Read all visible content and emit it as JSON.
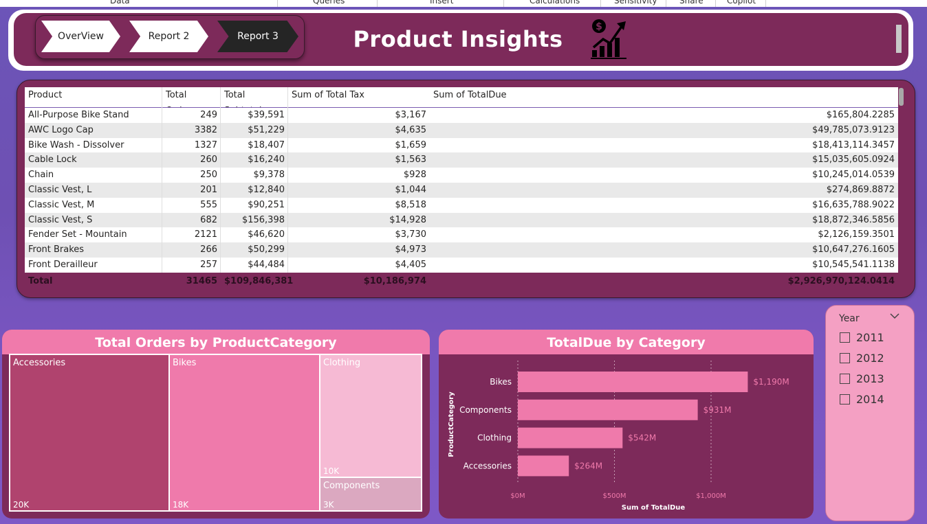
{
  "ribbon": {
    "tabs": [
      "Data",
      "Queries",
      "Insert",
      "Calculations",
      "Sensitivity",
      "Share",
      "Copilot"
    ]
  },
  "header": {
    "title": "Product Insights",
    "nav": [
      {
        "label": "OverView",
        "active": false
      },
      {
        "label": "Report 2",
        "active": false
      },
      {
        "label": "Report 3",
        "active": true
      }
    ],
    "icon": "dollar-growth-chart-icon"
  },
  "table": {
    "columns": [
      "Product",
      "Total Orders",
      "Total Subtotal",
      "Sum of Total Tax",
      "Sum of TotalDue"
    ],
    "rows": [
      [
        "All-Purpose Bike Stand",
        "249",
        "$39,591",
        "$3,167",
        "$165,804.2285"
      ],
      [
        "AWC Logo Cap",
        "3382",
        "$51,229",
        "$4,635",
        "$49,785,073.9123"
      ],
      [
        "Bike Wash - Dissolver",
        "1327",
        "$18,407",
        "$1,659",
        "$18,413,114.3457"
      ],
      [
        "Cable Lock",
        "260",
        "$16,240",
        "$1,563",
        "$15,035,605.0924"
      ],
      [
        "Chain",
        "250",
        "$9,378",
        "$928",
        "$10,245,014.0539"
      ],
      [
        "Classic Vest, L",
        "201",
        "$12,840",
        "$1,044",
        "$274,869.8872"
      ],
      [
        "Classic Vest, M",
        "555",
        "$90,251",
        "$8,518",
        "$16,635,788.9022"
      ],
      [
        "Classic Vest, S",
        "682",
        "$156,398",
        "$14,928",
        "$18,872,346.5856"
      ],
      [
        "Fender Set - Mountain",
        "2121",
        "$46,620",
        "$3,730",
        "$2,126,159.3501"
      ],
      [
        "Front Brakes",
        "266",
        "$50,299",
        "$4,973",
        "$10,647,276.1605"
      ],
      [
        "Front Derailleur",
        "257",
        "$44,484",
        "$4,405",
        "$10,545,541.1138"
      ]
    ],
    "total": [
      "Total",
      "31465",
      "$109,846,381",
      "$10,186,974",
      "$2,926,970,124.0414"
    ]
  },
  "treemap": {
    "title": "Total Orders by ProductCategory",
    "items": [
      {
        "label": "Accessories",
        "value_label": "20K",
        "color": "#b0436e"
      },
      {
        "label": "Bikes",
        "value_label": "18K",
        "color": "#ef7aab"
      },
      {
        "label": "Clothing",
        "value_label": "10K",
        "color": "#f6bad4"
      },
      {
        "label": "Components",
        "value_label": "3K",
        "color": "#dba8c0"
      }
    ]
  },
  "chart_data": {
    "type": "bar",
    "orientation": "horizontal",
    "title": "TotalDue by Category",
    "xlabel": "Sum of TotalDue",
    "ylabel": "ProductCategory",
    "categories": [
      "Bikes",
      "Components",
      "Clothing",
      "Accessories"
    ],
    "values": [
      1190,
      931,
      542,
      264
    ],
    "data_labels": [
      "$1,190M",
      "$931M",
      "$542M",
      "$264M"
    ],
    "unit": "M",
    "xlim": [
      0,
      1350
    ],
    "xticks": [
      0,
      500,
      1000
    ],
    "xtick_labels": [
      "$0M",
      "$500M",
      "$1,000M"
    ],
    "bar_color": "#ef7aab",
    "grid": true
  },
  "slicer": {
    "title": "Year",
    "options": [
      "2011",
      "2012",
      "2013",
      "2014"
    ]
  },
  "colors": {
    "panel": "#7d2a5a",
    "accent_pink": "#f07aab",
    "background": "#6e50b3"
  }
}
